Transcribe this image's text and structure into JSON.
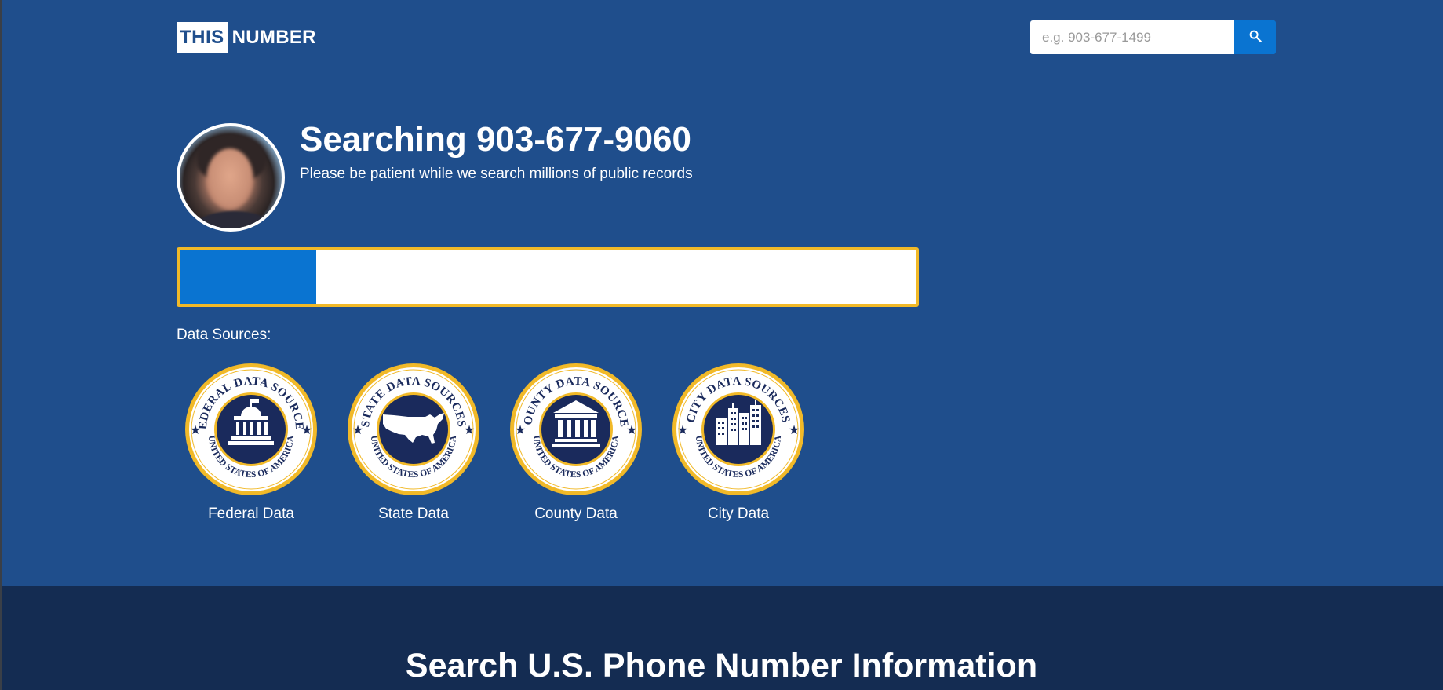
{
  "header": {
    "logo_left": "THIS",
    "logo_right": "NUMBER",
    "search": {
      "placeholder": "e.g. 903-677-1499",
      "button_icon": "search-icon"
    }
  },
  "search_status": {
    "title": "Searching 903-677-9060",
    "subtitle": "Please be patient while we search millions of public records",
    "progress_percent": 18.6
  },
  "data_sources": {
    "label": "Data Sources:",
    "items": [
      {
        "label": "Federal Data",
        "seal_top": "FEDERAL DATA SOURCES",
        "seal_bottom": "UNITED STATES OF AMERICA",
        "icon": "capitol-icon"
      },
      {
        "label": "State Data",
        "seal_top": "STATE DATA SOURCES",
        "seal_bottom": "UNITED STATES OF AMERICA",
        "icon": "usa-map-icon"
      },
      {
        "label": "County Data",
        "seal_top": "COUNTY DATA SOURCES",
        "seal_bottom": "UNITED STATES OF AMERICA",
        "icon": "courthouse-icon"
      },
      {
        "label": "City Data",
        "seal_top": "CITY DATA SOURCES",
        "seal_bottom": "UNITED STATES OF AMERICA",
        "icon": "city-buildings-icon"
      }
    ]
  },
  "lower_section": {
    "title": "Search U.S. Phone Number Information"
  },
  "colors": {
    "background": "#1f4e8c",
    "accent_blue": "#0a74d1",
    "progress_border": "#f1b928",
    "seal_navy": "#1a2a5c",
    "footer": "#142c52"
  }
}
